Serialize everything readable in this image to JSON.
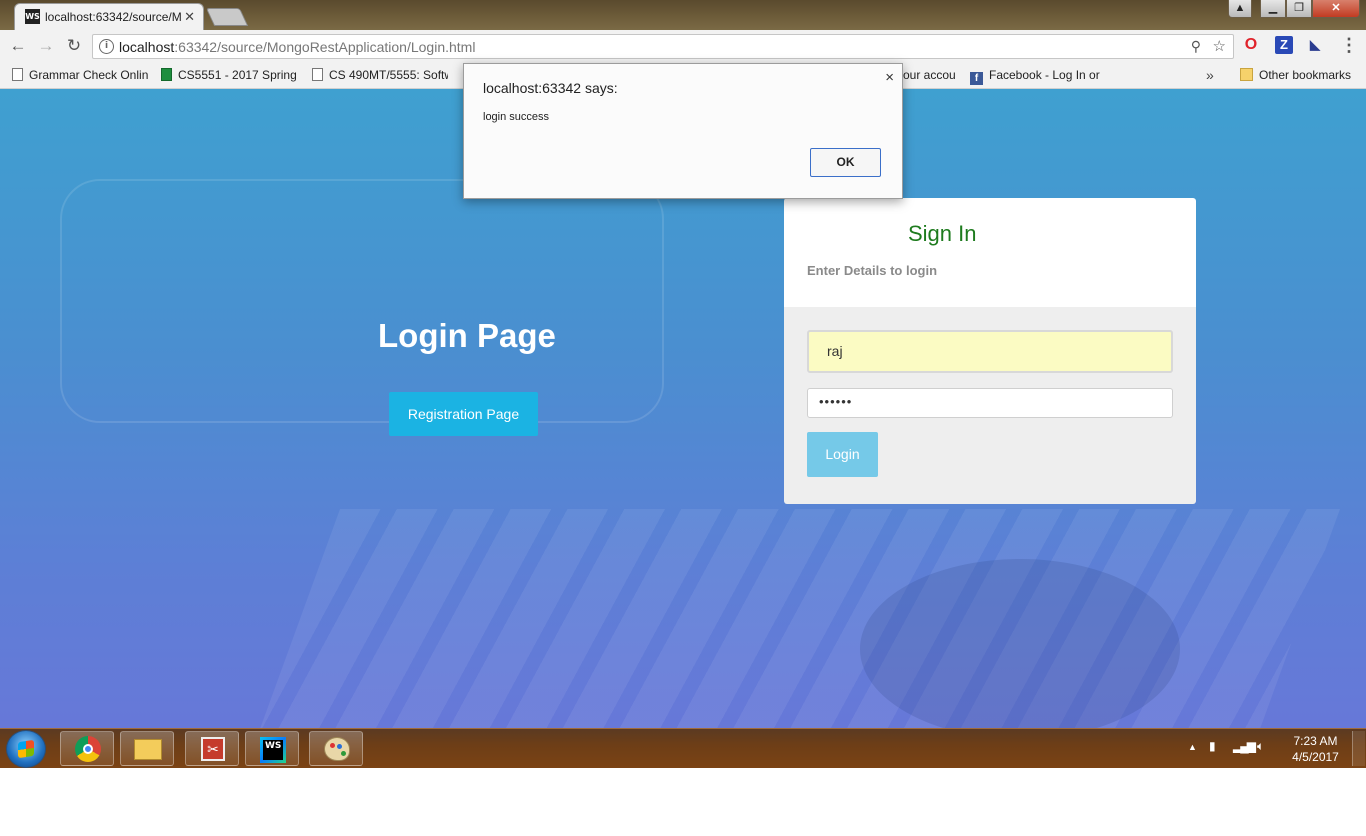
{
  "browser": {
    "tab_title": "localhost:63342/source/M",
    "tab_favicon": "WS",
    "address": {
      "host": "localhost",
      "path": ":63342/source/MongoRestApplication/Login.html"
    },
    "bookmarks": [
      {
        "label": "Grammar Check Onlin",
        "icon": "page-icon"
      },
      {
        "label": "CS5551 - 2017 Spring",
        "icon": "sheets-icon"
      },
      {
        "label": "CS 490MT/5555: Softw",
        "icon": "page-icon"
      },
      {
        "label": "our accou",
        "icon": "none"
      },
      {
        "label": "Facebook - Log In or",
        "icon": "facebook-icon"
      }
    ],
    "bookmarks_overflow": "»",
    "other_bookmarks": "Other bookmarks"
  },
  "page": {
    "hero_title": "Login Page",
    "registration_button": "Registration Page",
    "signin": {
      "title": "Sign In",
      "subtitle": "Enter Details to login",
      "username_value": "raj",
      "password_mask": "••••••",
      "login_button": "Login"
    }
  },
  "dialog": {
    "title": "localhost:63342 says:",
    "message": "login success",
    "ok_label": "OK",
    "close_glyph": "×"
  },
  "taskbar": {
    "time": "7:23 AM",
    "date": "4/5/2017",
    "apps": [
      "chrome",
      "file-explorer",
      "snipping-tool",
      "webstorm",
      "paint"
    ]
  }
}
